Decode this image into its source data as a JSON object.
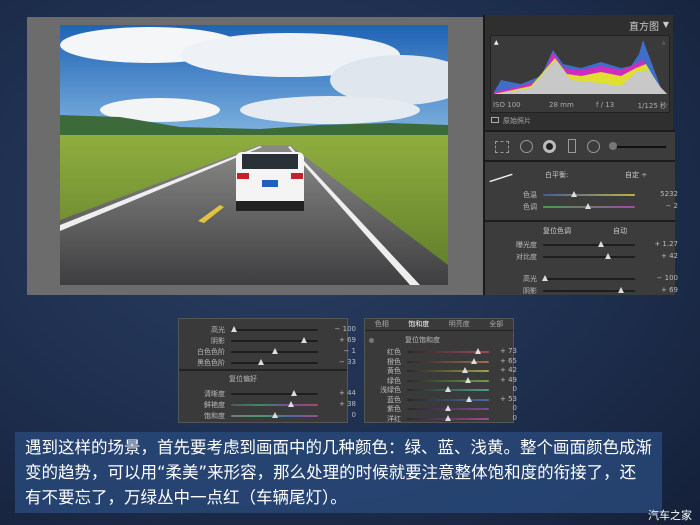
{
  "histogram": {
    "title": "直方图",
    "iso": "ISO 100",
    "focal": "28 mm",
    "aperture": "f / 13",
    "shutter": "1/125 秒",
    "original_photo": "原始照片"
  },
  "white_balance": {
    "label": "白平衡:",
    "mode": "自定 ÷",
    "sliders": [
      {
        "label": "色温",
        "value": "5232",
        "level": 0.34,
        "grad": "linear-gradient(90deg,#4a5a9a,#b5b34a)"
      },
      {
        "label": "色调",
        "value": "− 2",
        "level": 0.49,
        "grad": "linear-gradient(90deg,#4a9a4a,#a04aa0)"
      }
    ]
  },
  "tone": {
    "label": "复位色调",
    "auto": "自动",
    "sliders": [
      {
        "label": "曝光度",
        "value": "+ 1.27",
        "level": 0.63
      },
      {
        "label": "对比度",
        "value": "+ 42",
        "level": 0.71
      },
      {
        "label": "高光",
        "value": "− 100",
        "level": 0.02
      },
      {
        "label": "阴影",
        "value": "+ 69",
        "level": 0.85
      }
    ]
  },
  "presence_panel": {
    "tone_sliders": [
      {
        "label": "高光",
        "value": "− 100",
        "level": 0.03
      },
      {
        "label": "阴影",
        "value": "+ 69",
        "level": 0.84
      },
      {
        "label": "白色色阶",
        "value": "− 1",
        "level": 0.5
      },
      {
        "label": "黑色色阶",
        "value": "− 33",
        "level": 0.34
      }
    ],
    "presence_label": "复位偏好",
    "presence_sliders": [
      {
        "label": "清晰度",
        "value": "+ 44",
        "level": 0.72
      },
      {
        "label": "鲜艳度",
        "value": "+ 38",
        "level": 0.69,
        "grad": "linear-gradient(90deg,#555,#3a8a6a,#7a4a9a,#a04a6a)"
      },
      {
        "label": "饱和度",
        "value": "0",
        "level": 0.5,
        "grad": "linear-gradient(90deg,#777,#4a9a6a,#4a6aaa,#a04a8a)"
      }
    ]
  },
  "hsl_panel": {
    "tabs": [
      "色相",
      "饱和度",
      "明亮度",
      "全部"
    ],
    "active_tab": 1,
    "reset_label": "复位饱和度",
    "sliders": [
      {
        "label": "红色",
        "value": "+ 73",
        "level": 0.86,
        "color": "#a04a5a"
      },
      {
        "label": "橙色",
        "value": "+ 65",
        "level": 0.82,
        "color": "#a0704a"
      },
      {
        "label": "黄色",
        "value": "+ 42",
        "level": 0.71,
        "color": "#a0a04a"
      },
      {
        "label": "绿色",
        "value": "+ 49",
        "level": 0.74,
        "color": "#6aa04a"
      },
      {
        "label": "浅绿色",
        "value": "0",
        "level": 0.5,
        "color": "#4aa090"
      },
      {
        "label": "蓝色",
        "value": "+ 53",
        "level": 0.76,
        "color": "#4a6aa0"
      },
      {
        "label": "紫色",
        "value": "0",
        "level": 0.5,
        "color": "#7a4aa0"
      },
      {
        "label": "洋红",
        "value": "0",
        "level": 0.5,
        "color": "#a04a90"
      }
    ]
  },
  "caption": "遇到这样的场景，首先要考虑到画面中的几种颜色：绿、蓝、浅黄。整个画面颜色成渐变的趋势，可以用“柔美”来形容，那么处理的时候就要注意整体饱和度的衔接了，还有不要忘了，万绿丛中一点红（车辆尾灯）。",
  "watermark": "汽车之家"
}
